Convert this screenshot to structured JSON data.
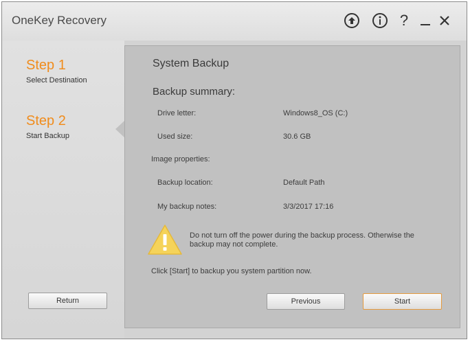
{
  "app": {
    "title": "OneKey Recovery"
  },
  "titlebar": {
    "buttons": [
      {
        "name": "upload-icon"
      },
      {
        "name": "info-icon"
      },
      {
        "name": "help-icon",
        "glyph": "?"
      },
      {
        "name": "minimize-icon"
      },
      {
        "name": "close-icon"
      }
    ]
  },
  "steps": [
    {
      "title": "Step 1",
      "subtitle": "Select Destination"
    },
    {
      "title": "Step 2",
      "subtitle": "Start Backup"
    }
  ],
  "main": {
    "heading": "System Backup",
    "summary_heading": "Backup summary:",
    "fields": [
      {
        "label": "Drive letter:",
        "value": "Windows8_OS (C:)"
      },
      {
        "label": "Used size:",
        "value": "30.6 GB"
      },
      {
        "label": "Image properties:",
        "value": ""
      },
      {
        "label": "Backup location:",
        "value": "Default Path"
      },
      {
        "label": "My backup notes:",
        "value": "3/3/2017 17:16"
      }
    ],
    "warning_line1": "Do not turn off the power during the backup process. Otherwise the",
    "warning_line2": "backup may not complete.",
    "instruction": "Click [Start] to backup you system partition now."
  },
  "buttons": {
    "return": "Return",
    "previous": "Previous",
    "start": "Start"
  },
  "colors": {
    "accent": "#f08c1c",
    "warning_yellow": "#f5d35a"
  }
}
